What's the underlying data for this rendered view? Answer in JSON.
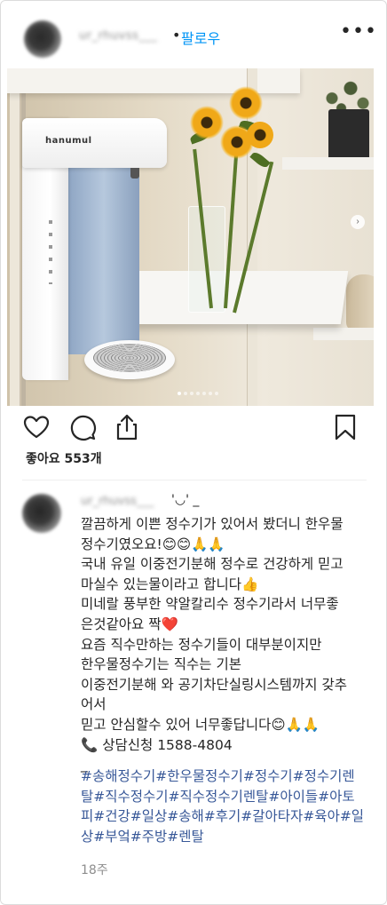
{
  "header": {
    "username_blurred": "ur_rhuvss___",
    "dot": "•",
    "follow_label": "팔로우",
    "more_label": "•••"
  },
  "photo": {
    "product_logo": "hanumul",
    "carousel_dots": 7,
    "active_dot": 0
  },
  "actions": {
    "likes_text": "좋아요 553개"
  },
  "comment": {
    "username_blurred": "ur_rhuvss___",
    "face": "'◡' _",
    "caption_lines": [
      "깔끔하게 이쁜 정수기가 있어서 봤더니 한우물",
      "정수기였오요!😊😊🙏🙏",
      "국내 유일 이중전기분해 정수로 건강하게 믿고",
      "마실수 있는물이라고 합니다👍",
      "미네랄 풍부한 약알칼리수 정수기라서 너무좋",
      "은것같아요 짝❤️",
      "요즘 직수만하는 정수기들이 대부분이지만",
      "한우물정수기는 직수는 기본",
      "이중전기분해 와 공기차단실링시스템까지 갖추",
      "어서",
      "믿고 안심할수 있어 너무좋답니다😊🙏🙏",
      "📞 상담신청 1588-4804",
      "_"
    ],
    "hashtag_lines": [
      "#송해정수기#한우물정수기#정수기#정수기렌",
      "탈#직수정수기#직수정수기렌탈#아이들#아토",
      "피#건강#일상#송해#후기#갈아타자#육아#일",
      "상#부엌#주방#렌탈"
    ],
    "time_ago": "18주"
  },
  "colors": {
    "accent": "#0095f6",
    "hashtag": "#385898",
    "muted": "#8e8e8e",
    "text": "#262626"
  },
  "icons": [
    "heart-icon",
    "comment-icon",
    "share-icon",
    "bookmark-icon",
    "more-icon"
  ]
}
